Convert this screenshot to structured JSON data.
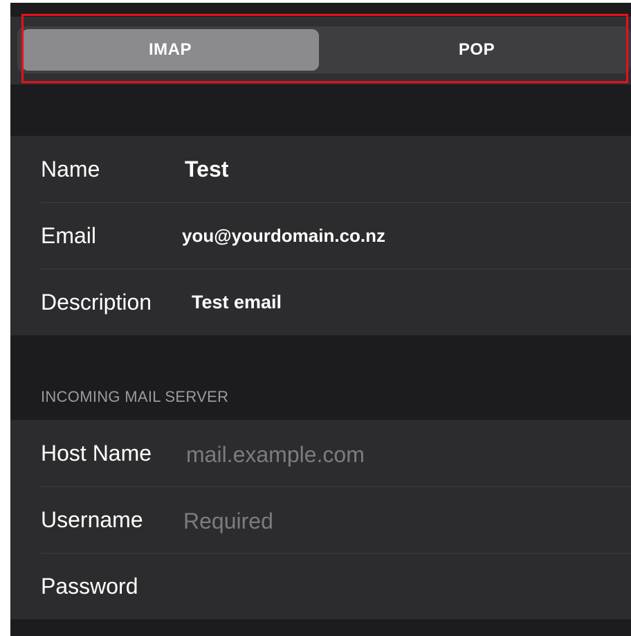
{
  "segments": {
    "imap": "IMAP",
    "pop": "POP",
    "selected": "IMAP"
  },
  "account": {
    "name_label": "Name",
    "name_value": "Test",
    "email_label": "Email",
    "email_value": "you@yourdomain.co.nz",
    "description_label": "Description",
    "description_value": "Test email"
  },
  "incoming": {
    "section_title": "INCOMING MAIL SERVER",
    "host_label": "Host Name",
    "host_placeholder": "mail.example.com",
    "username_label": "Username",
    "username_placeholder": "Required",
    "password_label": "Password",
    "password_placeholder": ""
  },
  "colors": {
    "highlight": "#e8101a",
    "selected_segment": "#8a8a8f",
    "background": "#1c1c1e",
    "cell": "#2c2c2e"
  }
}
